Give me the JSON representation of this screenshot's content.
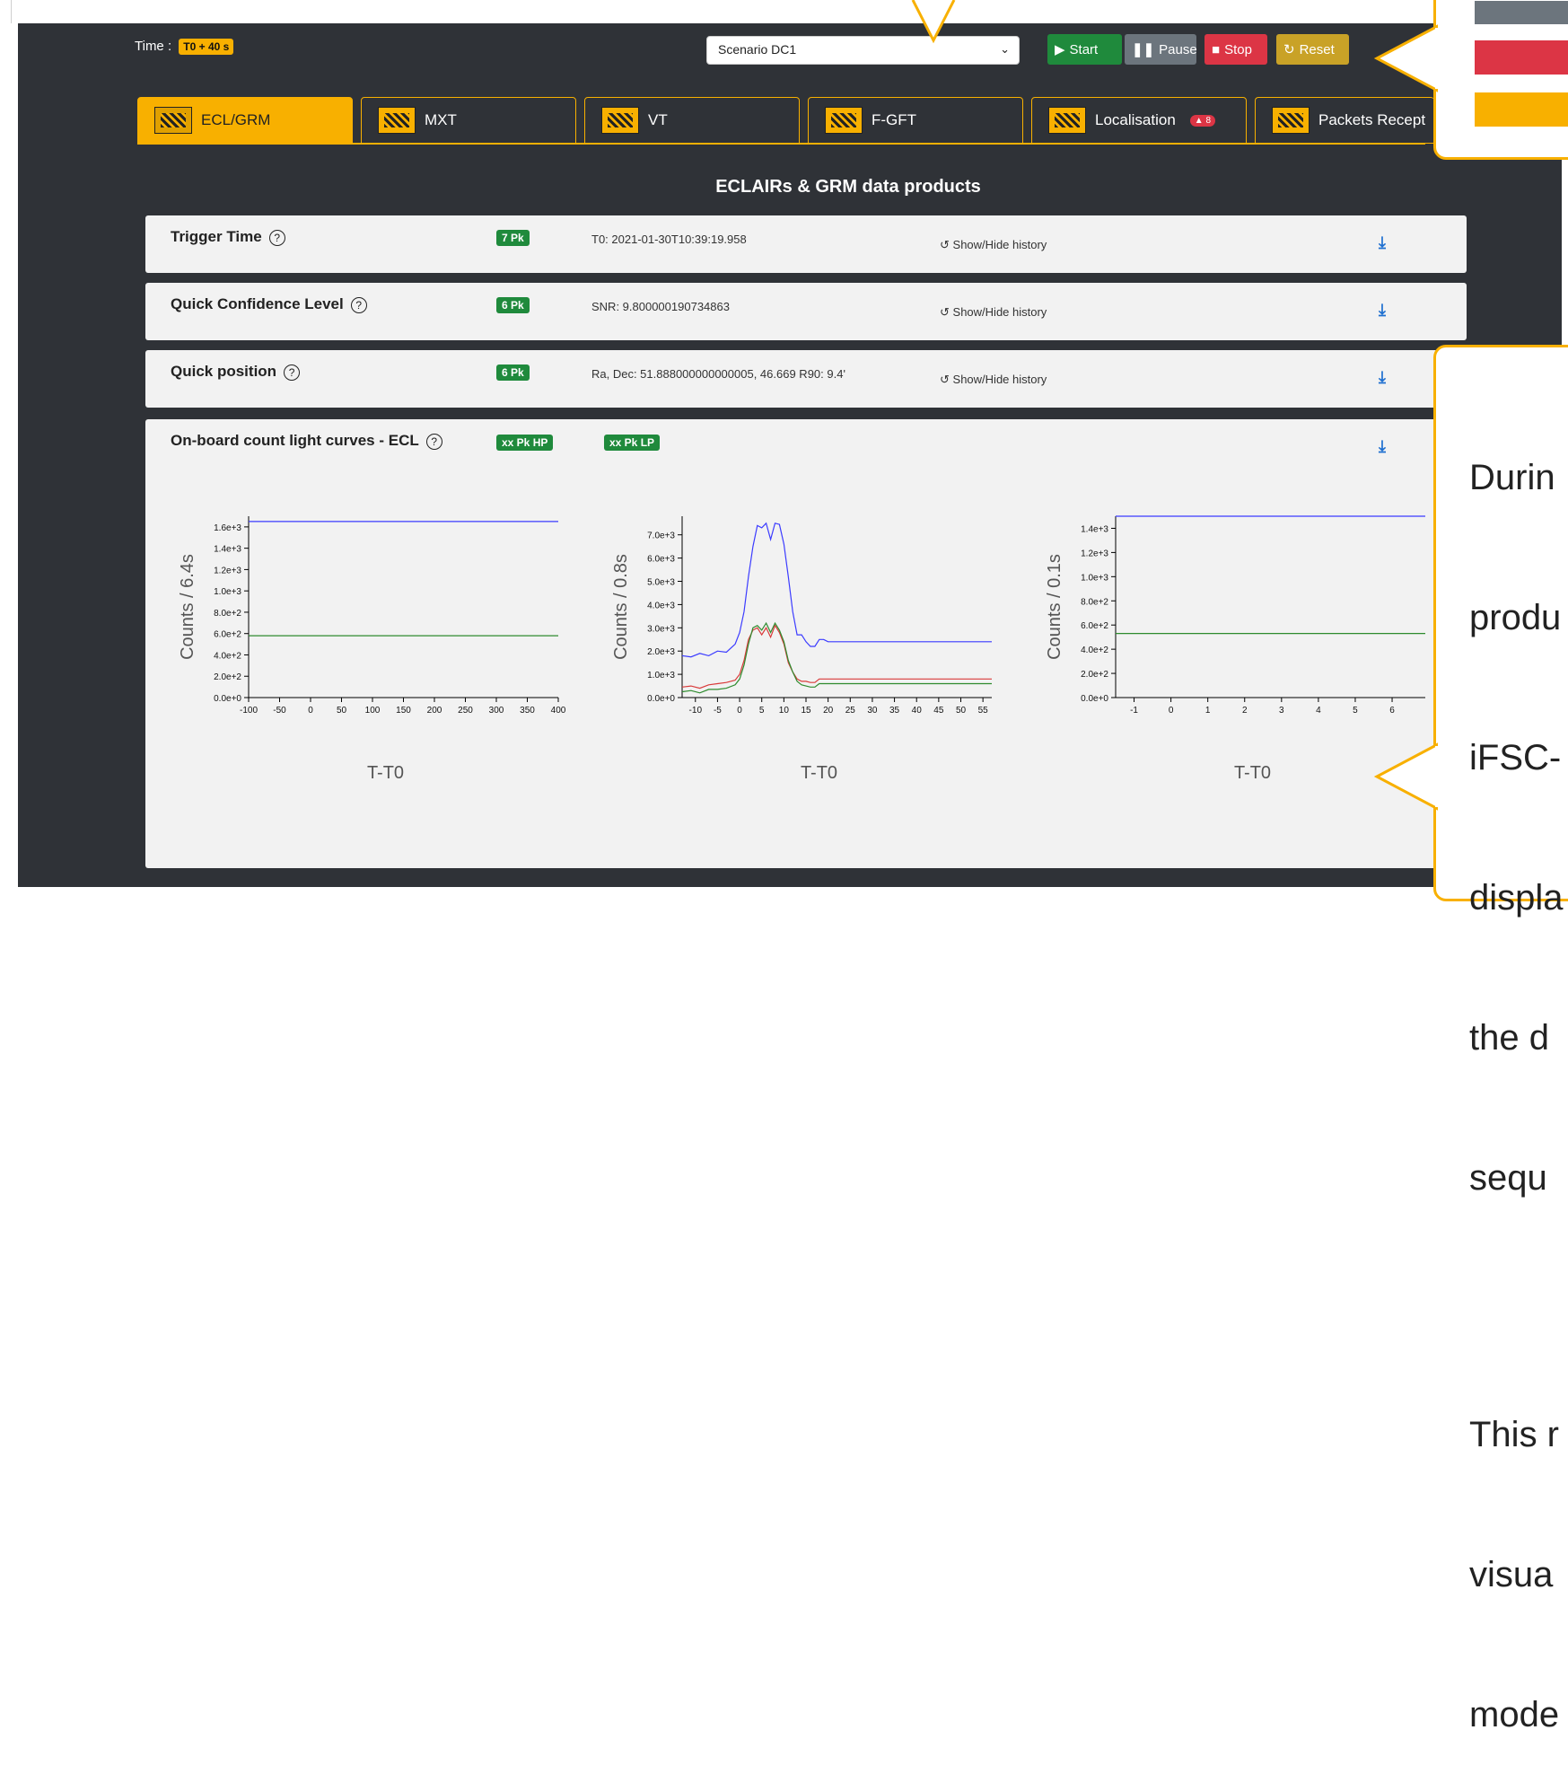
{
  "header": {
    "time_label": "Time :",
    "time_badge": "T0 + 40 s",
    "scenario": "Scenario DC1",
    "buttons": {
      "start": "Start",
      "pause": "Pause",
      "stop": "Stop",
      "reset": "Reset"
    }
  },
  "tabs": [
    {
      "label": "ECL/GRM",
      "active": true
    },
    {
      "label": "MXT"
    },
    {
      "label": "VT"
    },
    {
      "label": "F-GFT"
    },
    {
      "label": "Localisation",
      "badge": "8"
    },
    {
      "label": "Packets Recept"
    }
  ],
  "section_title": "ECLAIRs & GRM data products",
  "panels": {
    "trigger": {
      "title": "Trigger Time",
      "pk": "7 Pk",
      "value": "T0: 2021-01-30T10:39:19.958",
      "history": "Show/Hide history"
    },
    "confidence": {
      "title": "Quick Confidence Level",
      "pk": "6 Pk",
      "value": "SNR: 9.800000190734863",
      "history": "Show/Hide history"
    },
    "position": {
      "title": "Quick position",
      "pk": "6 Pk",
      "value": "Ra, Dec: 51.888000000000005, 46.669 R90: 9.4'",
      "history": "Show/Hide history"
    },
    "lightcurves": {
      "title": "On-board count light curves - ECL",
      "pk_hp": "xx Pk HP",
      "pk_lp": "xx Pk LP"
    }
  },
  "callout": {
    "lines": [
      "Durin",
      "produ",
      "iFSC-",
      "displa",
      "the d",
      "sequ",
      "",
      "This r",
      "visua",
      "mode"
    ]
  },
  "colors": {
    "accent": "#f8b000",
    "bg": "#2f3237",
    "green": "#1f8a3c",
    "red": "#dc3545",
    "blue": "#1e6fd0"
  },
  "chart_data": [
    {
      "type": "line",
      "ylabel": "Counts / 6.4s",
      "xlabel": "T-T0",
      "xlim": [
        -100,
        400
      ],
      "ylim": [
        0,
        1700
      ],
      "xticks": [
        "-100",
        "-50",
        "0",
        "50",
        "100",
        "150",
        "200",
        "250",
        "300",
        "350",
        "400"
      ],
      "yticks": [
        "0.0e+0",
        "2.0e+2",
        "4.0e+2",
        "6.0e+2",
        "8.0e+2",
        "1.0e+3",
        "1.2e+3",
        "1.4e+3",
        "1.6e+3"
      ],
      "series": [
        {
          "color": "#3b3bff",
          "x": [
            -100,
            400
          ],
          "y": [
            1650,
            1650
          ]
        },
        {
          "color": "#2e8b2e",
          "x": [
            -100,
            400
          ],
          "y": [
            580,
            580
          ]
        }
      ]
    },
    {
      "type": "line",
      "ylabel": "Counts / 0.8s",
      "xlabel": "T-T0",
      "xlim": [
        -13,
        57
      ],
      "ylim": [
        0,
        7800
      ],
      "xticks": [
        "-10",
        "-5",
        "0",
        "5",
        "10",
        "15",
        "20",
        "25",
        "30",
        "35",
        "40",
        "45",
        "50",
        "55"
      ],
      "yticks": [
        "0.0e+0",
        "1.0e+3",
        "2.0e+3",
        "3.0e+3",
        "4.0e+3",
        "5.0e+3",
        "6.0e+3",
        "7.0e+3"
      ],
      "series": [
        {
          "color": "#3b3bff",
          "x": [
            -13,
            -11,
            -9,
            -7,
            -5,
            -3,
            -1,
            0,
            1,
            2,
            3,
            4,
            5,
            6,
            7,
            8,
            9,
            10,
            11,
            12,
            13,
            14,
            15,
            16,
            17,
            18,
            19,
            20,
            57
          ],
          "y": [
            1800,
            1750,
            1900,
            1800,
            2000,
            1950,
            2300,
            2800,
            3700,
            5200,
            6500,
            7400,
            7300,
            7500,
            6800,
            7500,
            7450,
            6600,
            5200,
            3700,
            2700,
            2700,
            2400,
            2200,
            2200,
            2500,
            2500,
            2400,
            2400
          ]
        },
        {
          "color": "#d93b3b",
          "x": [
            -13,
            -11,
            -9,
            -7,
            -5,
            -3,
            -1,
            0,
            1,
            2,
            3,
            4,
            5,
            6,
            7,
            8,
            9,
            10,
            11,
            12,
            13,
            14,
            15,
            16,
            17,
            18,
            57
          ],
          "y": [
            450,
            500,
            400,
            550,
            600,
            650,
            750,
            1000,
            1600,
            2500,
            2900,
            3000,
            2700,
            3000,
            2600,
            3100,
            2800,
            2300,
            1500,
            1100,
            800,
            700,
            700,
            650,
            650,
            800,
            800
          ]
        },
        {
          "color": "#2e8b2e",
          "x": [
            -13,
            -11,
            -9,
            -7,
            -5,
            -3,
            -1,
            0,
            1,
            2,
            3,
            4,
            5,
            6,
            7,
            8,
            9,
            10,
            11,
            12,
            13,
            14,
            15,
            16,
            17,
            18,
            57
          ],
          "y": [
            250,
            300,
            200,
            350,
            350,
            400,
            550,
            800,
            1400,
            2300,
            3000,
            3100,
            2900,
            3200,
            2800,
            3200,
            2900,
            2400,
            1600,
            1100,
            700,
            550,
            500,
            450,
            450,
            600,
            600
          ]
        }
      ]
    },
    {
      "type": "line",
      "ylabel": "Counts / 0.1s",
      "xlabel": "T-T0",
      "xlim": [
        -1.5,
        6.9
      ],
      "ylim": [
        0,
        1500
      ],
      "xticks": [
        "-1",
        "0",
        "1",
        "2",
        "3",
        "4",
        "5",
        "6"
      ],
      "yticks": [
        "0.0e+0",
        "2.0e+2",
        "4.0e+2",
        "6.0e+2",
        "8.0e+2",
        "1.0e+3",
        "1.2e+3",
        "1.4e+3"
      ],
      "series": [
        {
          "color": "#3b3bff",
          "x": [
            -1.5,
            6.9
          ],
          "y": [
            1500,
            1500
          ]
        },
        {
          "color": "#2e8b2e",
          "x": [
            -1.5,
            6.9
          ],
          "y": [
            530,
            530
          ]
        }
      ]
    }
  ]
}
